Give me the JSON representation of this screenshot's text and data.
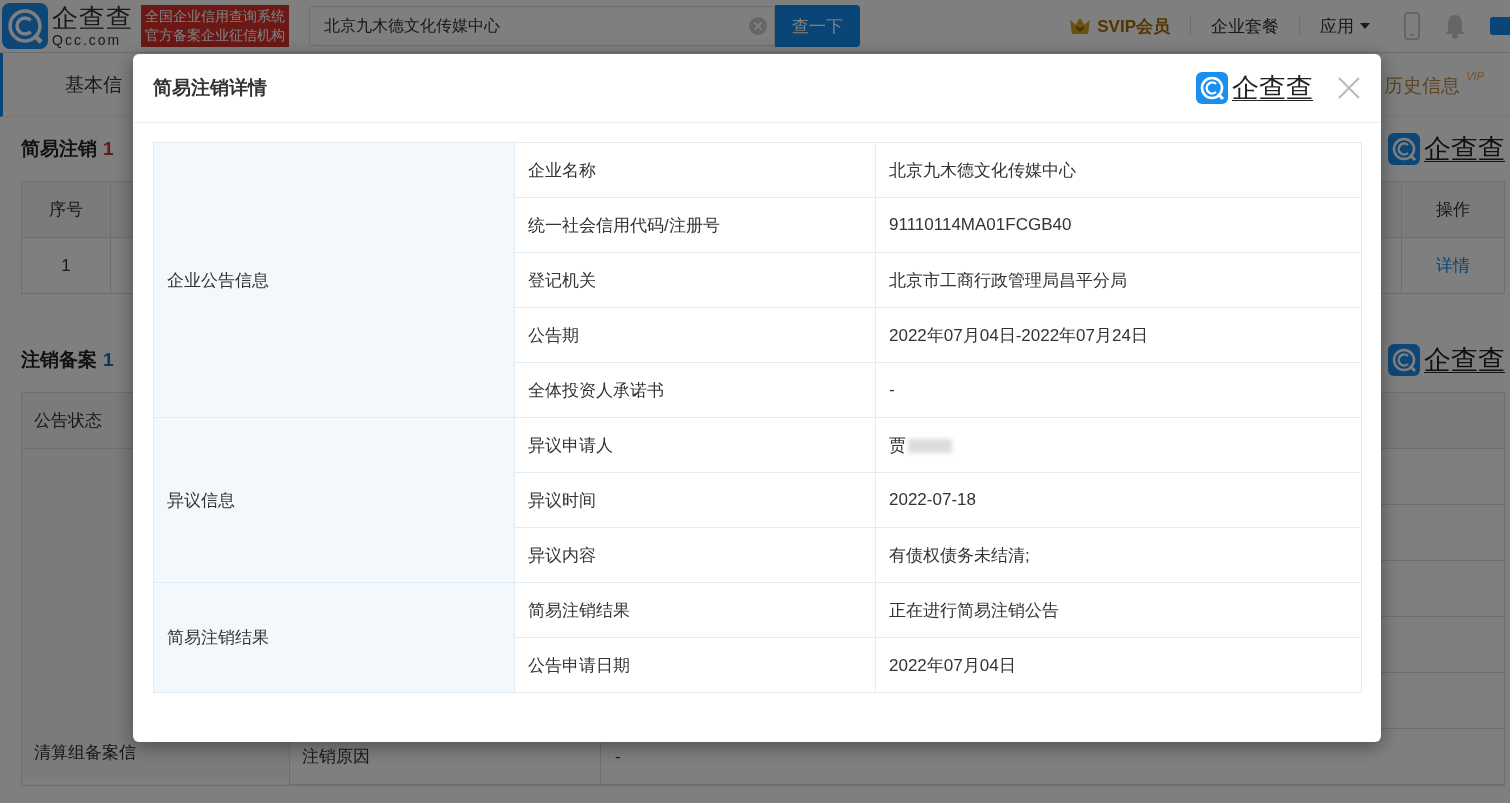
{
  "header": {
    "logo_text": "企查查",
    "logo_domain": "Qcc.com",
    "slogan_lines": [
      "全国企业信用查询系统",
      "官方备案企业征信机构"
    ],
    "search": {
      "value": "北京九木德文化传媒中心"
    },
    "search_button": "查一下",
    "vip": "SVIP会员",
    "nav": [
      {
        "label": "企业套餐",
        "kind": "link"
      },
      {
        "label": "应用",
        "kind": "dropdown"
      }
    ]
  },
  "tabs": [
    {
      "label": "基本信",
      "selected": false
    },
    {
      "label": "历史信息",
      "badge": "VIP",
      "selected": false
    }
  ],
  "cancel_section": {
    "title": "简易注销",
    "count": "1",
    "logo_text": "企查查",
    "columns": [
      "序号",
      "操作"
    ],
    "rows": [
      {
        "index": "1",
        "action": "详情"
      }
    ]
  },
  "filing_section": {
    "title": "注销备案",
    "count": "1",
    "logo_text": "企查查",
    "rows": [
      {
        "label": "公告状态"
      },
      {
        "label": "清算组备案信",
        "sub_label": "注销原因",
        "value": "-"
      }
    ]
  },
  "modal": {
    "title": "简易注销详情",
    "logo_text": "企查查",
    "groups": [
      {
        "label": "企业公告信息",
        "rows": [
          {
            "label": "企业名称",
            "value": "北京九木德文化传媒中心"
          },
          {
            "label": "统一社会信用代码/注册号",
            "value": "91110114MA01FCGB40"
          },
          {
            "label": "登记机关",
            "value": "北京市工商行政管理局昌平分局"
          },
          {
            "label": "公告期",
            "value": "2022年07月04日-2022年07月24日"
          },
          {
            "label": "全体投资人承诺书",
            "value": "-"
          }
        ]
      },
      {
        "label": "异议信息",
        "rows": [
          {
            "label": "异议申请人",
            "value": "贾",
            "redacted": true
          },
          {
            "label": "异议时间",
            "value": "2022-07-18"
          },
          {
            "label": "异议内容",
            "value": "有债权债务未结清;"
          }
        ]
      },
      {
        "label": "简易注销结果",
        "rows": [
          {
            "label": "简易注销结果",
            "value": "正在进行简易注销公告"
          },
          {
            "label": "公告申请日期",
            "value": "2022年07月04日"
          }
        ]
      }
    ]
  }
}
